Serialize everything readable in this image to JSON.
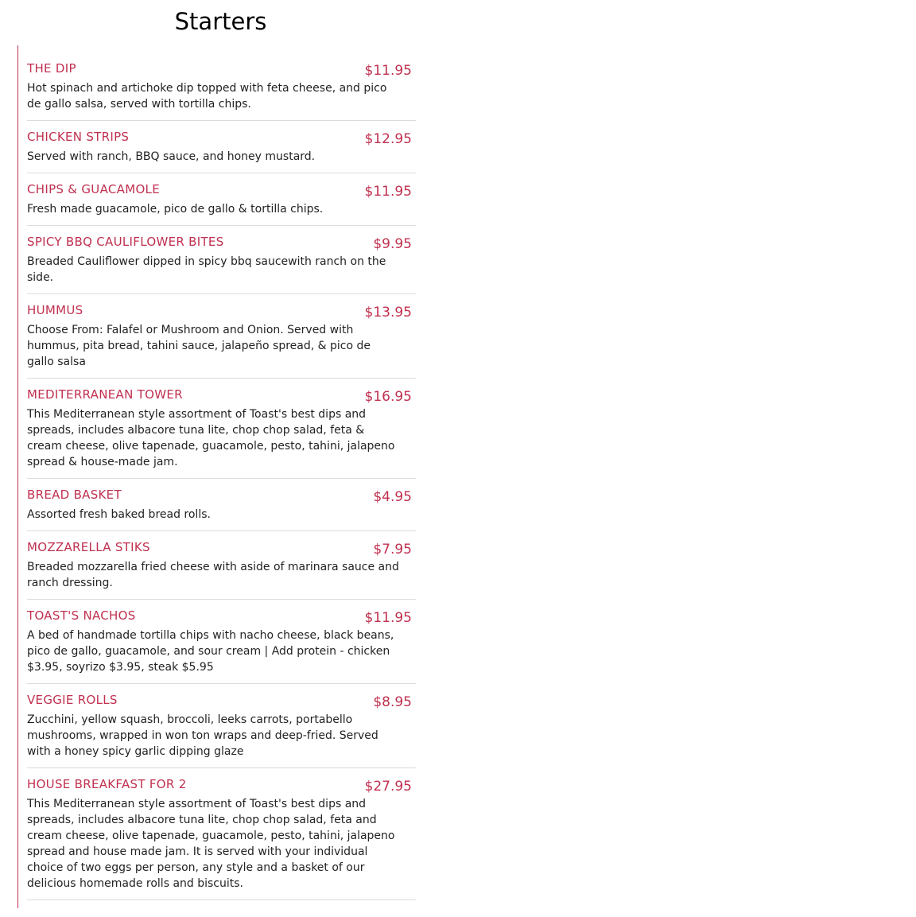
{
  "page": {
    "title": "Starters"
  },
  "theme": {
    "accent": "#c0304f",
    "divider": "#dcdcdc",
    "text": "#222222"
  },
  "items": [
    {
      "name": "THE DIP",
      "price": "$11.95",
      "description": "Hot spinach and artichoke dip topped with feta cheese, and pico de gallo salsa, served with tortilla chips."
    },
    {
      "name": "CHICKEN STRIPS",
      "price": "$12.95",
      "description": "Served with ranch, BBQ sauce, and honey mustard."
    },
    {
      "name": "CHIPS & GUACAMOLE",
      "price": "$11.95",
      "description": "Fresh made guacamole, pico de gallo & tortilla chips."
    },
    {
      "name": "SPICY BBQ CAULIFLOWER BITES",
      "price": "$9.95",
      "description": "Breaded Cauliflower dipped in spicy bbq saucewith ranch on the side."
    },
    {
      "name": "HUMMUS",
      "price": "$13.95",
      "description": "Choose From: Falafel or Mushroom and Onion. Served with hummus, pita bread, tahini sauce, jalapeño spread, & pico de gallo salsa"
    },
    {
      "name": "MEDITERRANEAN TOWER",
      "price": "$16.95",
      "description": "This Mediterranean style assortment of Toast's best dips and spreads, includes albacore tuna lite, chop chop salad, feta & cream cheese, olive tapenade, guacamole, pesto, tahini, jalapeno spread & house-made jam."
    },
    {
      "name": "BREAD BASKET",
      "price": "$4.95",
      "description": "Assorted fresh baked bread rolls."
    },
    {
      "name": "MOZZARELLA STIKS",
      "price": "$7.95",
      "description": "Breaded mozzarella fried cheese with aside of marinara sauce and ranch dressing."
    },
    {
      "name": "TOAST'S NACHOS",
      "price": "$11.95",
      "description": "A bed of handmade tortilla chips with nacho cheese, black beans, pico de gallo, guacamole, and sour cream | Add protein - chicken $3.95, soyrizo $3.95, steak $5.95"
    },
    {
      "name": "VEGGIE ROLLS",
      "price": "$8.95",
      "description": "Zucchini, yellow squash, broccoli, leeks carrots, portabello mushrooms, wrapped in won ton wraps and deep-fried. Served with a honey spicy garlic dipping glaze"
    },
    {
      "name": "HOUSE BREAKFAST FOR 2",
      "price": "$27.95",
      "description": "This Mediterranean style assortment of Toast's best dips and spreads, includes albacore tuna lite, chop chop salad, feta and cream cheese, olive tapenade, guacamole, pesto, tahini, jalapeno spread and house made jam. It is served with your individual choice of two eggs per person, any style and a basket of our delicious homemade rolls and biscuits."
    }
  ]
}
